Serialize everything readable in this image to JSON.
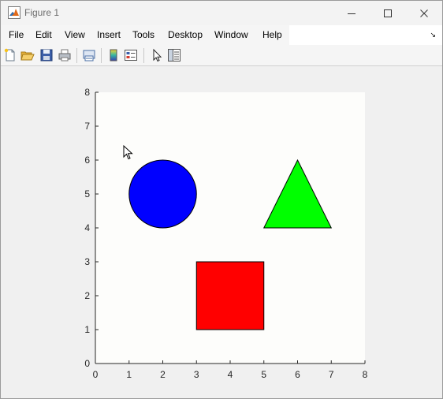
{
  "window": {
    "title": "Figure 1",
    "controls": [
      "minimize",
      "maximize",
      "close"
    ]
  },
  "menu": {
    "items": [
      "File",
      "Edit",
      "View",
      "Insert",
      "Tools",
      "Desktop",
      "Window",
      "Help"
    ],
    "expander": "↘"
  },
  "toolbar": {
    "icons": [
      "new-figure-icon",
      "open-file-icon",
      "save-icon",
      "print-icon",
      "link-plot-icon",
      "insert-colorbar-icon",
      "insert-legend-icon",
      "edit-plot-pointer-icon",
      "property-inspector-icon"
    ]
  },
  "axes": {
    "xlim": [
      0,
      8
    ],
    "ylim": [
      0,
      8
    ],
    "xticks": [
      "0",
      "1",
      "2",
      "3",
      "4",
      "5",
      "6",
      "7",
      "8"
    ],
    "yticks": [
      "0",
      "1",
      "2",
      "3",
      "4",
      "5",
      "6",
      "7",
      "8"
    ],
    "background": "#fdfdfb",
    "grid": false
  },
  "shapes": [
    {
      "type": "circle",
      "center": [
        2,
        5
      ],
      "radius": 1,
      "color": "#0000ff"
    },
    {
      "type": "triangle",
      "vertices": [
        [
          5,
          4
        ],
        [
          7,
          4
        ],
        [
          6,
          6
        ]
      ],
      "color": "#00ff00"
    },
    {
      "type": "rectangle",
      "corner": [
        3,
        1
      ],
      "width": 2,
      "height": 2,
      "color": "#ff0000"
    }
  ]
}
